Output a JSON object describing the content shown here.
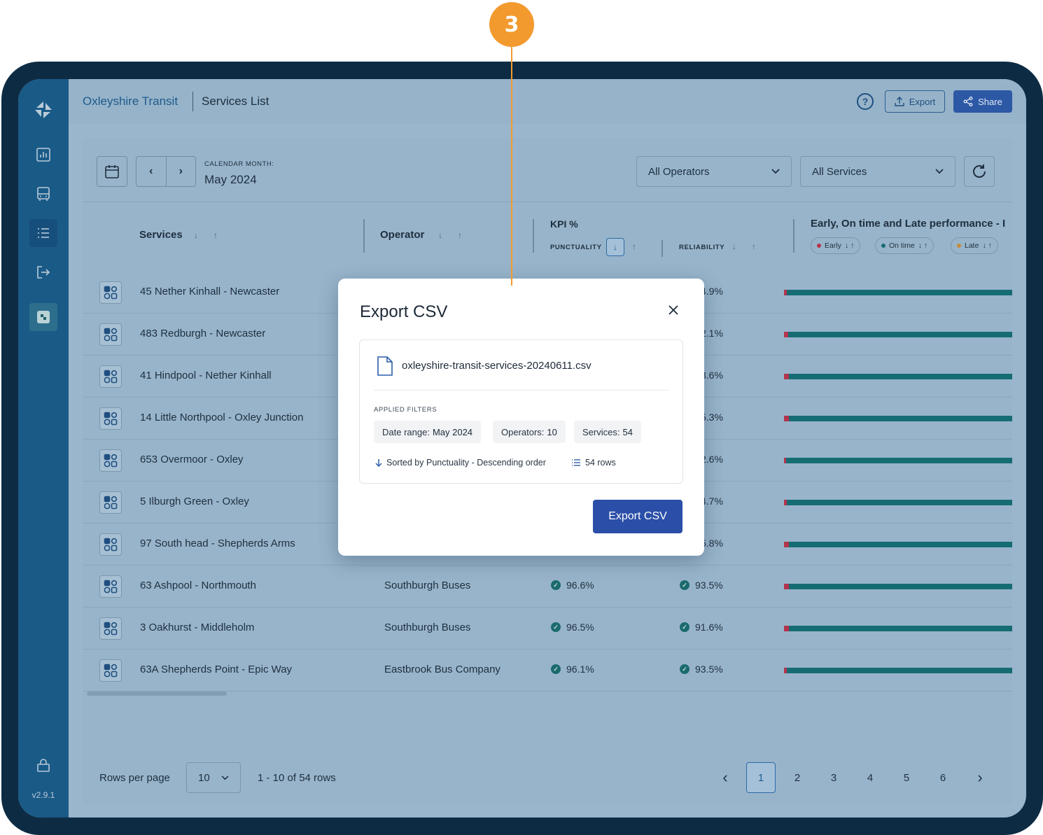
{
  "callout": {
    "number": "3"
  },
  "app": {
    "name": "Oxleyshire Transit",
    "page": "Services List",
    "version": "v2.9.1"
  },
  "sidebar": {
    "items": [
      {
        "icon": "logo-icon"
      },
      {
        "icon": "chart-icon"
      },
      {
        "icon": "bus-icon"
      },
      {
        "icon": "list-icon",
        "active": true
      },
      {
        "icon": "exit-icon"
      },
      {
        "icon": "app-tile-icon"
      }
    ],
    "lock_icon": "lock-icon"
  },
  "toolbar": {
    "export_label": "Export",
    "share_label": "Share",
    "help_icon": "help-icon"
  },
  "filters": {
    "month_caption": "CALENDAR MONTH:",
    "month_value": "May 2024",
    "operators_select": "All Operators",
    "services_select": "All Services"
  },
  "table": {
    "headers": {
      "services": "Services",
      "operator": "Operator",
      "kpi": "KPI %",
      "punctuality": "PUNCTUALITY",
      "reliability": "RELIABILITY",
      "performance": "Early, On time and Late performance - I",
      "pills": [
        "Early",
        "On time",
        "Late"
      ]
    },
    "rows": [
      {
        "service": "45 Nether Kinhall - Newcaster",
        "operator": "",
        "punctuality": "",
        "reliability": "4.9%",
        "early": 1.2,
        "ontime": 98.8
      },
      {
        "service": "483 Redburgh - Newcaster",
        "operator": "",
        "punctuality": "",
        "reliability": "2.1%",
        "early": 1.8,
        "ontime": 98.2
      },
      {
        "service": "41 Hindpool - Nether Kinhall",
        "operator": "",
        "punctuality": "",
        "reliability": "3.6%",
        "early": 2.1,
        "ontime": 97.9
      },
      {
        "service": "14 Little Northpool - Oxley Junction",
        "operator": "",
        "punctuality": "",
        "reliability": "5.3%",
        "early": 2.1,
        "ontime": 97.9
      },
      {
        "service": "653 Overmoor - Oxley",
        "operator": "",
        "punctuality": "",
        "reliability": "2.6%",
        "early": 0.9,
        "ontime": 99.1
      },
      {
        "service": "5 Ilburgh Green - Oxley",
        "operator": "",
        "punctuality": "",
        "reliability": "4.7%",
        "early": 1.2,
        "ontime": 98.8
      },
      {
        "service": "97 South head - Shepherds Arms",
        "operator": "",
        "punctuality": "",
        "reliability": "5.8%",
        "early": 2.1,
        "ontime": 97.9
      },
      {
        "service": "63 Ashpool - Northmouth",
        "operator": "Southburgh Buses",
        "punctuality": "96.6%",
        "reliability": "93.5%",
        "early": 2.1,
        "ontime": 97.9
      },
      {
        "service": "3 Oakhurst - Middleholm",
        "operator": "Southburgh Buses",
        "punctuality": "96.5%",
        "reliability": "91.6%",
        "early": 2.1,
        "ontime": 97.9
      },
      {
        "service": "63A Shepherds Point - Epic Way",
        "operator": "Eastbrook Bus Company",
        "punctuality": "96.1%",
        "reliability": "93.5%",
        "early": 1.2,
        "ontime": 98.8
      }
    ]
  },
  "pagination": {
    "rows_per_page_label": "Rows per page",
    "rows_per_page_value": "10",
    "range_text": "1 - 10 of 54 rows",
    "pages": [
      "1",
      "2",
      "3",
      "4",
      "5",
      "6"
    ],
    "current": "1"
  },
  "modal": {
    "title": "Export CSV",
    "file_name": "oxleyshire-transit-services-20240611.csv",
    "applied_filters_label": "APPLIED FILTERS",
    "chips": [
      {
        "key": "Date range:",
        "value": "May 2024"
      },
      {
        "key": "Operators:",
        "value": "10"
      },
      {
        "key": "Services:",
        "value": "54"
      }
    ],
    "sorted_text": "Sorted by Punctuality - Descending order",
    "rows_text": "54 rows",
    "export_button": "Export CSV"
  },
  "colors": {
    "accent": "#2b4fa8",
    "callout": "#f39a2f",
    "early": "#b3344d",
    "ontime": "#156c73",
    "late": "#c88a3a"
  }
}
